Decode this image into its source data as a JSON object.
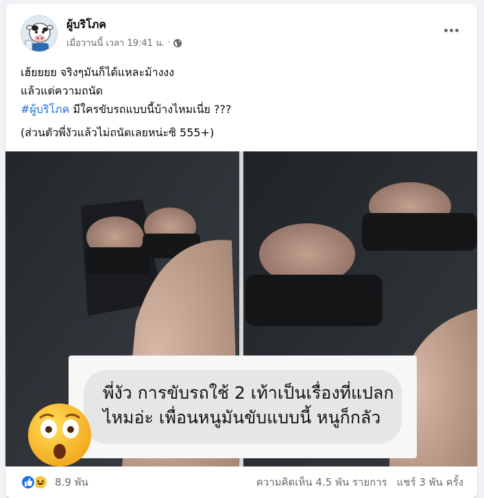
{
  "post": {
    "page_name": "ผู้บริโภค",
    "timestamp": "เมื่อวานนี้ เวลา 19:41 น.",
    "separator": "·",
    "audience_icon": "globe-icon",
    "more_icon": "more-options-icon",
    "text_lines": [
      "เฮ้ยยยย จริงๆมันก็ได้แหละม้างงง",
      "แล้วแต่ความถนัด"
    ],
    "hashtag": "#ผู้บริโภค",
    "hashtag_rest": " มีใครขับรถแบบนี้บ้างไหมเนี่ย ???",
    "note": "(ส่วนตัวพี่งัวแล้วไม่ถนัดเลยหน่ะซิ 555+)"
  },
  "image": {
    "caption_lines": [
      "พี่งัว การขับรถใช้ 2 เท้าเป็นเรื่องที่แปลก",
      "ไหมอ่ะ เพื่อนหนูมันขับแบบนี้ หนูก็กลัว"
    ],
    "emoji": "astonished-face-icon"
  },
  "footer": {
    "reaction_icons": [
      "like-icon",
      "haha-icon"
    ],
    "reaction_count": "8.9 พัน",
    "comments": "ความคิดเห็น 4.5 พัน รายการ",
    "shares": "แชร์ 3 พัน ครั้ง"
  },
  "colors": {
    "hashtag": "#216fdb",
    "secondary_text": "#65676b",
    "like_blue": "#1b74e4"
  }
}
